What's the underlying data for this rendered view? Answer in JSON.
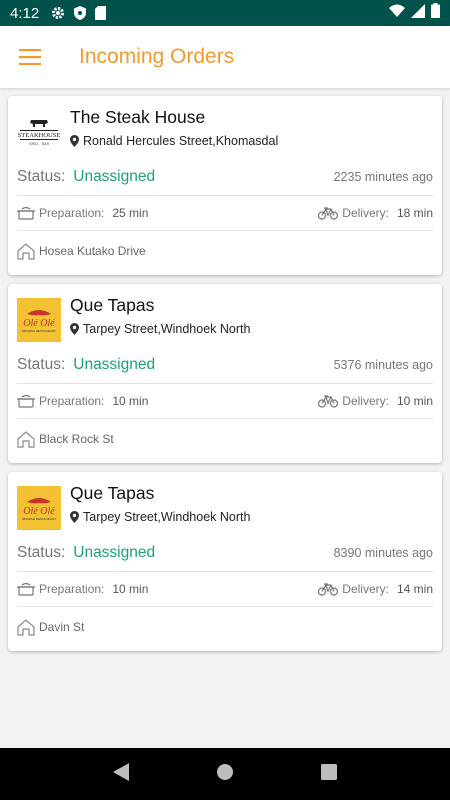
{
  "status_bar": {
    "time": "4:12"
  },
  "header": {
    "title": "Incoming Orders"
  },
  "status_label": "Status:",
  "prep_label": "Preparation:",
  "delivery_label": "Delivery:",
  "orders": [
    {
      "restaurant": "The Steak House",
      "logo": "steakhouse-logo",
      "address": "Ronald Hercules Street,Khomasdal",
      "status": "Unassigned",
      "elapsed": "2235 minutes ago",
      "preparation": "25 min",
      "delivery": "18 min",
      "destination": "Hosea Kutako Drive"
    },
    {
      "restaurant": "Que Tapas",
      "logo": "ole-ole-logo",
      "address": "Tarpey Street,Windhoek North",
      "status": "Unassigned",
      "elapsed": "5376 minutes ago",
      "preparation": "10 min",
      "delivery": "10 min",
      "destination": "Black Rock St"
    },
    {
      "restaurant": "Que Tapas",
      "logo": "ole-ole-logo",
      "address": "Tarpey Street,Windhoek North",
      "status": "Unassigned",
      "elapsed": "8390 minutes ago",
      "preparation": "10 min",
      "delivery": "14 min",
      "destination": "Davin St"
    }
  ],
  "colors": {
    "accent": "#f39a2c",
    "status_bar": "#00524a",
    "status_ok": "#1aa374"
  }
}
